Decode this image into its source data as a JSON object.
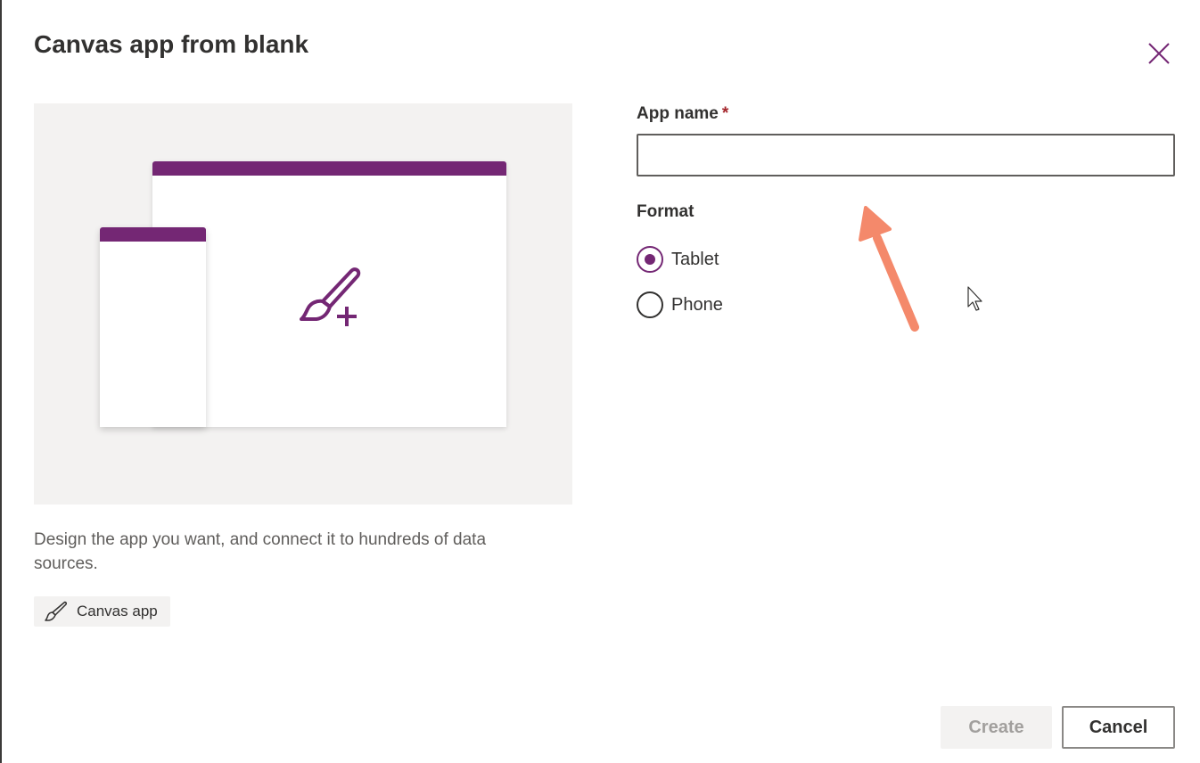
{
  "dialog": {
    "title": "Canvas app from blank",
    "close_icon": "close-icon"
  },
  "preview": {
    "accent_color": "#742774",
    "icon": "paintbrush-plus-icon"
  },
  "description": "Design the app you want, and connect it to hundreds of data sources.",
  "tag": {
    "icon": "paintbrush-icon",
    "label": "Canvas app"
  },
  "form": {
    "app_name": {
      "label": "App name",
      "required_marker": "*",
      "value": "",
      "placeholder": ""
    },
    "format": {
      "label": "Format",
      "options": [
        {
          "label": "Tablet",
          "selected": true
        },
        {
          "label": "Phone",
          "selected": false
        }
      ]
    }
  },
  "buttons": {
    "create": {
      "label": "Create",
      "disabled": true
    },
    "cancel": {
      "label": "Cancel"
    }
  },
  "annotation": {
    "arrow_color": "#f4896b"
  }
}
